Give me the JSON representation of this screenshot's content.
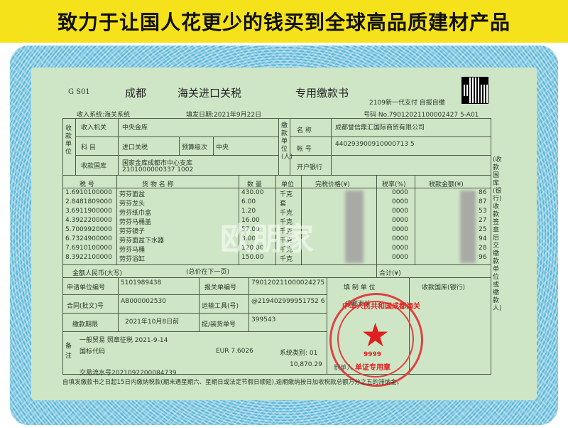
{
  "banner": "致力于让国人花更少的钱买到全球高品质建材产品",
  "header": {
    "code": "G S01",
    "city": "成都",
    "title": "海关进口关税",
    "subtitle": "专用缴款书",
    "pay_mode": "2109新一代支付  自报自缴",
    "collect_system": "收入系统:海关系统",
    "fill_date": "填发日期:2021年9月22日",
    "number": "号码 No.79012021100002427 5-A01"
  },
  "collector": {
    "label_side": "收款单位",
    "rows": [
      {
        "label": "收入机关",
        "value": "中央金库"
      },
      {
        "label": "科 目",
        "value": "进口关税",
        "label2": "预算级次",
        "value2": "中央"
      },
      {
        "label": "收款国库",
        "value": "国家金库成都市中心支库",
        "value_extra": "2101000000337 1002"
      }
    ]
  },
  "payer": {
    "label_side": "缴款单位(人)",
    "rows": [
      {
        "label": "名 称",
        "value": "成都誉信鼎汇国际商贸有限公司"
      },
      {
        "label": "帐 号",
        "value": "440293900910000713 5"
      },
      {
        "label": "开户银行",
        "value": ""
      }
    ]
  },
  "goods_header": [
    "税 号",
    "货 物 名 称",
    "数 量",
    "单位",
    "完税价格(¥)",
    "税率(%)",
    "税款金额(¥)"
  ],
  "goods": [
    {
      "no": "1.6910100000",
      "name": "劳芬面盆",
      "qty": "430.00",
      "unit": "千克",
      "rate": "0000",
      "tax": "86"
    },
    {
      "no": "2.8481809000",
      "name": "劳芬龙头",
      "qty": "6.00",
      "unit": "套",
      "rate": "0000",
      "tax": "87"
    },
    {
      "no": "3.6911900000",
      "name": "劳芬纸巾盒",
      "qty": "1.20",
      "unit": "千克",
      "rate": "0000",
      "tax": "53"
    },
    {
      "no": "4.3922200000",
      "name": "劳芬马桶盖",
      "qty": "16.00",
      "unit": "千克",
      "rate": "0000",
      "tax": "27"
    },
    {
      "no": "5.7009920000",
      "name": "劳芬镜子",
      "qty": "57.00",
      "unit": "千克",
      "rate": "0000",
      "tax": "25"
    },
    {
      "no": "6.7324900000",
      "name": "劳芬面盆下水器",
      "qty": "3.00",
      "unit": "千克",
      "rate": "0000",
      "tax": "94"
    },
    {
      "no": "7.6910100000",
      "name": "劳芬马桶",
      "qty": "120.00",
      "unit": "千克",
      "rate": "0000",
      "tax": "28"
    },
    {
      "no": "8.3922100000",
      "name": "劳芬浴缸",
      "qty": "150.00",
      "unit": "千克",
      "rate": "0000",
      "tax": "96"
    }
  ],
  "amount_upper_label": "金额人民币(大写)",
  "amount_upper_value": "(总价在下一页)",
  "total_label": "合计(¥)",
  "side_note": "(收款国库(银行)收款签章后交缴款单位或缴款人)",
  "info": {
    "apply_no_label": "申请单位编号",
    "apply_no": "5101989438",
    "customs_no_label": "报关单编号",
    "customs_no": "790120211000024275",
    "contract_label": "合同(批文)号",
    "contract": "AB000002530",
    "transport_label": "运输工具(号)",
    "transport": "@219402999951752 6",
    "deadline_label": "缴款期限",
    "deadline": "2021年10月8日前",
    "bill_label": "提/装货单号",
    "bill": "399543",
    "fill_unit_label": "填 制 单 位",
    "treasury_label": "收款国库(银行)",
    "fill_unit_partial": "成都海关"
  },
  "notes": {
    "label": "备注",
    "line1": "一般贸易 照章征税 2021-9-14",
    "line2": "国标代码",
    "currency": "EUR 7.6026",
    "system_class": "系统类别: 01",
    "amount": "10,870.29",
    "serial": "交易流水号2021092200084739",
    "stamp_no": "9999",
    "stamp_text": "单证专用章",
    "stamp_ring": "中华人民共和国成都海关",
    "maker": "制单人"
  },
  "footer": "自填发缴款书之日起15日内缴纳税款(期末遇星期六、星期日或法定节假日顺延),逾期缴纳按日加收税款总额万分之五的滞纳金。",
  "watermark": "欧朋家"
}
